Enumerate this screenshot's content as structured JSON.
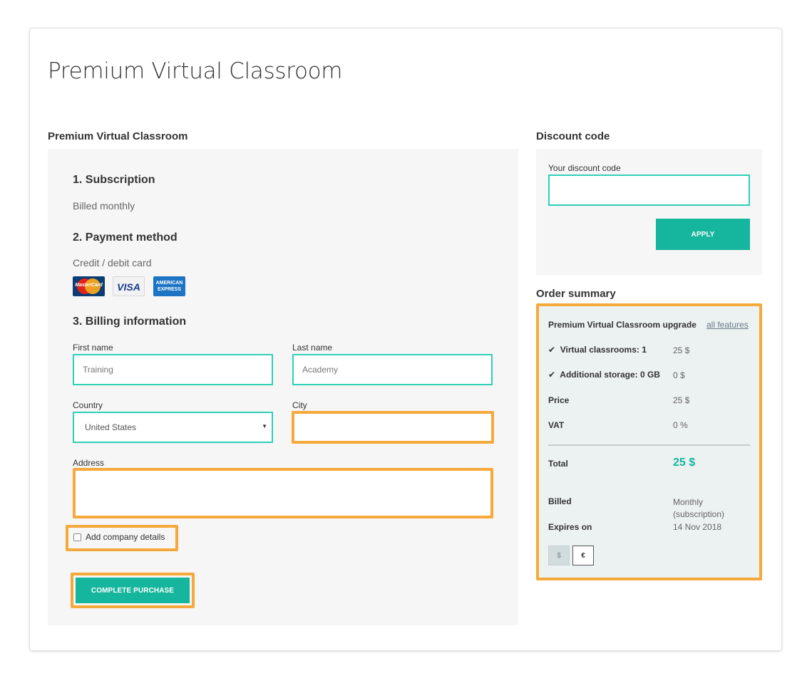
{
  "page_title": "Premium Virtual Classroom",
  "left_heading": "Premium Virtual Classroom",
  "subscription": {
    "heading": "1. Subscription",
    "text": "Billed monthly"
  },
  "payment": {
    "heading": "2. Payment method",
    "text": "Credit / debit card",
    "cards": {
      "mastercard": "MasterCard",
      "visa": "VISA",
      "amex_line1": "AMERICAN",
      "amex_line2": "EXPRESS"
    }
  },
  "billing": {
    "heading": "3. Billing information",
    "first_name": {
      "label": "First name",
      "value": "Training"
    },
    "last_name": {
      "label": "Last name",
      "value": "Academy"
    },
    "country": {
      "label": "Country",
      "value": "United States"
    },
    "city": {
      "label": "City",
      "value": ""
    },
    "address": {
      "label": "Address",
      "value": ""
    },
    "company_checkbox": {
      "label": "Add company details",
      "checked": false
    },
    "submit_label": "COMPLETE PURCHASE"
  },
  "discount": {
    "heading": "Discount code",
    "field_label": "Your discount code",
    "value": "",
    "apply_label": "APPLY"
  },
  "order_summary": {
    "heading": "Order summary",
    "product": "Premium Virtual Classroom upgrade",
    "features_link": "all features",
    "items": [
      {
        "label": "Virtual classrooms: 1",
        "value": "25 $"
      },
      {
        "label": "Additional storage: 0 GB",
        "value": "0 $"
      }
    ],
    "price": {
      "label": "Price",
      "value": "25 $"
    },
    "vat": {
      "label": "VAT",
      "value": "0 %"
    },
    "total": {
      "label": "Total",
      "value": "25 $"
    },
    "billed": {
      "label": "Billed",
      "value_line1": "Monthly",
      "value_line2": "(subscription)"
    },
    "expires": {
      "label": "Expires on",
      "value": "14 Nov 2018"
    },
    "currencies": [
      "$",
      "€"
    ],
    "selected_currency": "€"
  },
  "colors": {
    "accent": "#16b59d",
    "input_border": "#2ed0b7",
    "highlight": "#f6a93b",
    "panel": "#f6f6f6",
    "summary_bg": "#ecf1f1"
  }
}
